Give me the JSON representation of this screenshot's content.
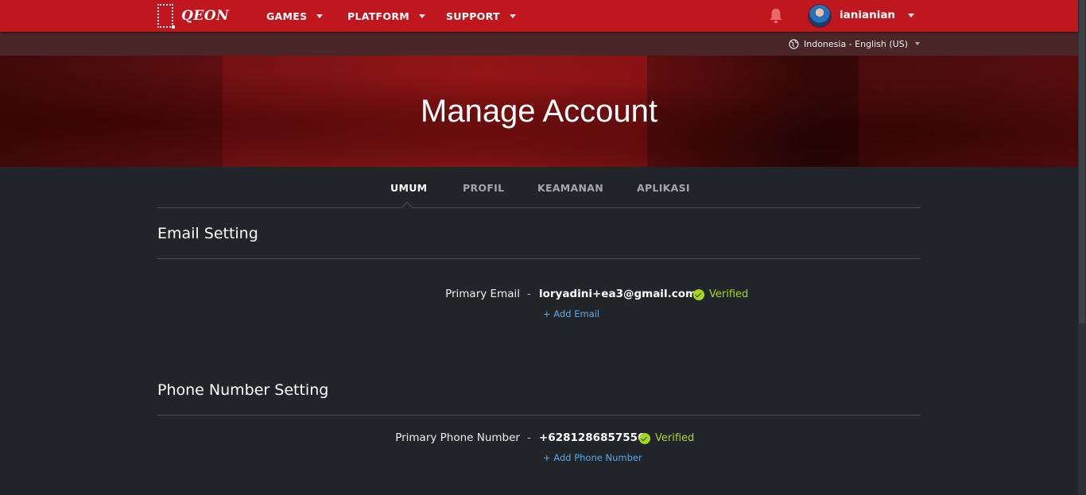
{
  "brand": {
    "name": "QEON"
  },
  "nav": {
    "items": [
      {
        "label": "GAMES"
      },
      {
        "label": "PLATFORM"
      },
      {
        "label": "SUPPORT"
      }
    ]
  },
  "user": {
    "name": "ianianian"
  },
  "locale": {
    "label": "Indonesia - English (US)"
  },
  "hero": {
    "title": "Manage Account"
  },
  "tabs": [
    {
      "label": "UMUM",
      "active": true
    },
    {
      "label": "PROFIL",
      "active": false
    },
    {
      "label": "KEAMANAN",
      "active": false
    },
    {
      "label": "APLIKASI",
      "active": false
    }
  ],
  "email_section": {
    "title": "Email Setting",
    "label": "Primary Email",
    "separator": "-",
    "value": "loryadini+ea3@gmail.com",
    "status": "Verified",
    "add_link": "+ Add Email"
  },
  "phone_section": {
    "title": "Phone Number Setting",
    "label": "Primary Phone Number",
    "separator": "-",
    "value": "+6281286857556",
    "status": "Verified",
    "add_link": "+ Add Phone Number"
  },
  "colors": {
    "nav_bg": "#c0161d",
    "page_bg": "#212429",
    "verified": "#a3d91a",
    "link": "#5aa8e6"
  },
  "icons": [
    "qeon-logo-icon",
    "chevron-down-icon",
    "bell-icon",
    "globe-icon",
    "check-circle-icon"
  ]
}
